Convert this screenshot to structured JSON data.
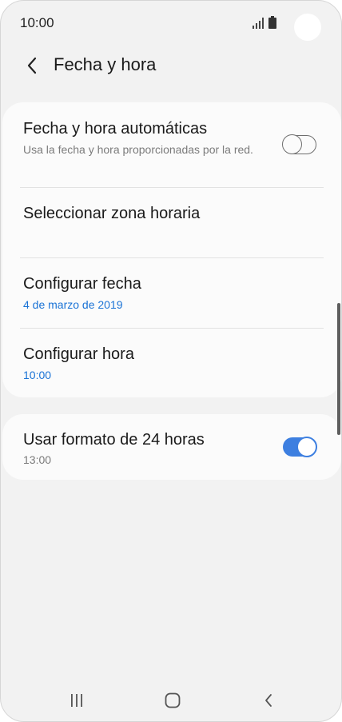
{
  "status_bar": {
    "time": "10:00"
  },
  "header": {
    "back_icon": "chevron-left-icon",
    "title": "Fecha y hora"
  },
  "settings": {
    "auto_datetime": {
      "title": "Fecha y hora automáticas",
      "subtitle": "Usa la fecha y hora proporcionadas por la red.",
      "toggle": "off"
    },
    "timezone": {
      "title": "Seleccionar zona horaria"
    },
    "set_date": {
      "title": "Configurar fecha",
      "value": "4 de marzo de 2019"
    },
    "set_time": {
      "title": "Configurar hora",
      "value": "10:00"
    },
    "format_24h": {
      "title": "Usar formato de 24 horas",
      "value": "13:00",
      "toggle": "on"
    }
  },
  "nav_bar": {
    "recents_icon": "recents-icon",
    "home_icon": "home-icon",
    "back_icon": "back-icon"
  },
  "colors": {
    "accent": "#1a73d6",
    "toggle_on": "#3d7fe0",
    "background": "#f2f2f2",
    "card": "#fbfbfb"
  }
}
